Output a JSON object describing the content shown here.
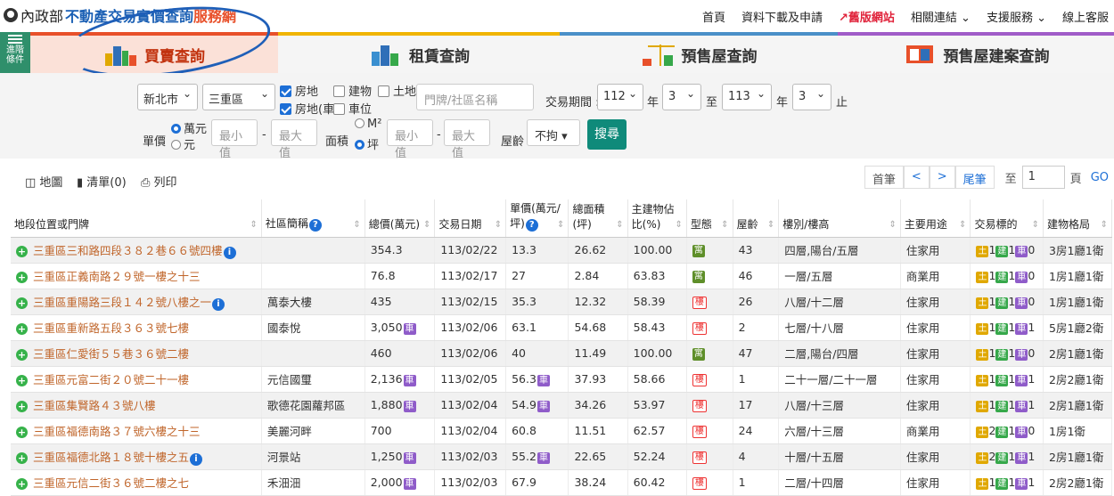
{
  "header": {
    "logo_moi": "內政部",
    "logo_title1": "不動產交易實價查詢",
    "logo_title2": "服務網",
    "nav": [
      "首頁",
      "資料下載及申請",
      "舊版網站",
      "相關連結 ⌄",
      "支援服務 ⌄",
      "線上客服"
    ]
  },
  "side": {
    "label1": "進階",
    "label2": "條件"
  },
  "tabs": [
    "買賣查詢",
    "租賃查詢",
    "預售屋查詢",
    "預售屋建案查詢"
  ],
  "filters": {
    "city": "新北市",
    "district": "三重區",
    "chk_land_house": "房地",
    "chk_building": "建物",
    "chk_land": "土地",
    "chk_house_car": "房地(車)",
    "chk_parking": "車位",
    "addr_placeholder": "門牌/社區名稱",
    "period_label": "交易期間 :",
    "y1": "112",
    "m1": "3",
    "y2": "113",
    "m2": "3",
    "yr": "年",
    "to": "至",
    "stop": "止",
    "price_label": "單價",
    "unit_wan": "萬元",
    "unit_yuan": "元",
    "min": "最小值",
    "max": "最大值",
    "area_label": "面積",
    "unit_m2": "M²",
    "unit_ping": "坪",
    "age_label": "屋齡",
    "age_value": "不拘 ▾",
    "search": "搜尋"
  },
  "toolbar": {
    "map": "地圖",
    "list": "清單(0)",
    "print": "列印"
  },
  "pager": {
    "first": "首筆",
    "prev": "<",
    "next": ">",
    "last": "尾筆",
    "to": "至",
    "page": "1",
    "page_unit": "頁",
    "go": "GO"
  },
  "columns": [
    "地段位置或門牌",
    "社區簡稱",
    "總價(萬元)",
    "交易日期",
    "單價(萬元/坪)",
    "總面積(坪)",
    "主建物佔比(%)",
    "型態",
    "屋齡",
    "樓別/樓高",
    "主要用途",
    "交易標的",
    "建物格局"
  ],
  "rows": [
    {
      "addr": "三重區三和路四段３８２巷６６號四樓",
      "info": true,
      "community": "",
      "total": "354.3",
      "tcar": false,
      "date": "113/02/22",
      "unit": "13.3",
      "ucar": false,
      "area": "26.62",
      "ratio": "100.00",
      "type": "寓",
      "age": "43",
      "floor": "四層,陽台/五層",
      "use": "住家用",
      "lot": [
        "1",
        "1",
        "0"
      ],
      "layout": "3房1廳1衛"
    },
    {
      "addr": "三重區正義南路２９號一樓之十三",
      "info": false,
      "community": "",
      "total": "76.8",
      "tcar": false,
      "date": "113/02/17",
      "unit": "27",
      "ucar": false,
      "area": "2.84",
      "ratio": "63.83",
      "type": "寓",
      "age": "46",
      "floor": "一層/五層",
      "use": "商業用",
      "lot": [
        "1",
        "1",
        "0"
      ],
      "layout": "1房1廳1衛"
    },
    {
      "addr": "三重區重陽路三段１４２號八樓之一",
      "info": true,
      "community": "萬泰大樓",
      "total": "435",
      "tcar": false,
      "date": "113/02/15",
      "unit": "35.3",
      "ucar": false,
      "area": "12.32",
      "ratio": "58.39",
      "type": "樓",
      "age": "26",
      "floor": "八層/十二層",
      "use": "住家用",
      "lot": [
        "1",
        "1",
        "0"
      ],
      "layout": "1房1廳1衛"
    },
    {
      "addr": "三重區重新路五段３６３號七樓",
      "info": false,
      "community": "國泰悅",
      "total": "3,050",
      "tcar": true,
      "date": "113/02/06",
      "unit": "63.1",
      "ucar": false,
      "area": "54.68",
      "ratio": "58.43",
      "type": "樓",
      "age": "2",
      "floor": "七層/十八層",
      "use": "住家用",
      "lot": [
        "1",
        "1",
        "1"
      ],
      "layout": "5房1廳2衛"
    },
    {
      "addr": "三重區仁愛街５５巷３６號二樓",
      "info": false,
      "community": "",
      "total": "460",
      "tcar": false,
      "date": "113/02/06",
      "unit": "40",
      "ucar": false,
      "area": "11.49",
      "ratio": "100.00",
      "type": "寓",
      "age": "47",
      "floor": "二層,陽台/四層",
      "use": "住家用",
      "lot": [
        "1",
        "1",
        "0"
      ],
      "layout": "2房1廳1衛"
    },
    {
      "addr": "三重區元富二街２０號二十一樓",
      "info": false,
      "community": "元信國璽",
      "total": "2,136",
      "tcar": true,
      "date": "113/02/05",
      "unit": "56.3",
      "ucar": true,
      "area": "37.93",
      "ratio": "58.66",
      "type": "樓",
      "age": "1",
      "floor": "二十一層/二十一層",
      "use": "住家用",
      "lot": [
        "1",
        "1",
        "1"
      ],
      "layout": "2房2廳1衛"
    },
    {
      "addr": "三重區集賢路４３號八樓",
      "info": false,
      "community": "歌德花園蘿邦區",
      "total": "1,880",
      "tcar": true,
      "date": "113/02/04",
      "unit": "54.9",
      "ucar": true,
      "area": "34.26",
      "ratio": "53.97",
      "type": "樓",
      "age": "17",
      "floor": "八層/十三層",
      "use": "住家用",
      "lot": [
        "1",
        "1",
        "1"
      ],
      "layout": "2房1廳1衛"
    },
    {
      "addr": "三重區福德南路３７號六樓之十三",
      "info": false,
      "community": "美麗河畔",
      "total": "700",
      "tcar": false,
      "date": "113/02/04",
      "unit": "60.8",
      "ucar": false,
      "area": "11.51",
      "ratio": "62.57",
      "type": "樓",
      "age": "24",
      "floor": "六層/十三層",
      "use": "商業用",
      "lot": [
        "2",
        "1",
        "0"
      ],
      "layout": "1房1衛"
    },
    {
      "addr": "三重區福德北路１８號十樓之五",
      "info": true,
      "community": "河景站",
      "total": "1,250",
      "tcar": true,
      "date": "113/02/03",
      "unit": "55.2",
      "ucar": true,
      "area": "22.65",
      "ratio": "52.24",
      "type": "樓",
      "age": "4",
      "floor": "十層/十五層",
      "use": "住家用",
      "lot": [
        "2",
        "1",
        "1"
      ],
      "layout": "2房1廳1衛"
    },
    {
      "addr": "三重區元信二街３６號二樓之七",
      "info": false,
      "community": "禾沺沺",
      "total": "2,000",
      "tcar": true,
      "date": "113/02/03",
      "unit": "67.9",
      "ucar": false,
      "area": "38.24",
      "ratio": "60.42",
      "type": "樓",
      "age": "1",
      "floor": "二層/十四層",
      "use": "住家用",
      "lot": [
        "1",
        "1",
        "1"
      ],
      "layout": "2房2廳1衛"
    }
  ],
  "labels": {
    "car": "車",
    "land": "土",
    "bldg": "建",
    "park": "車",
    "plus": "+",
    "info": "i"
  },
  "colors": {
    "accent": "#e8502a",
    "brand_blue": "#1a5fb4",
    "search_btn": "#0f8a7a",
    "address": "#c0652a"
  }
}
